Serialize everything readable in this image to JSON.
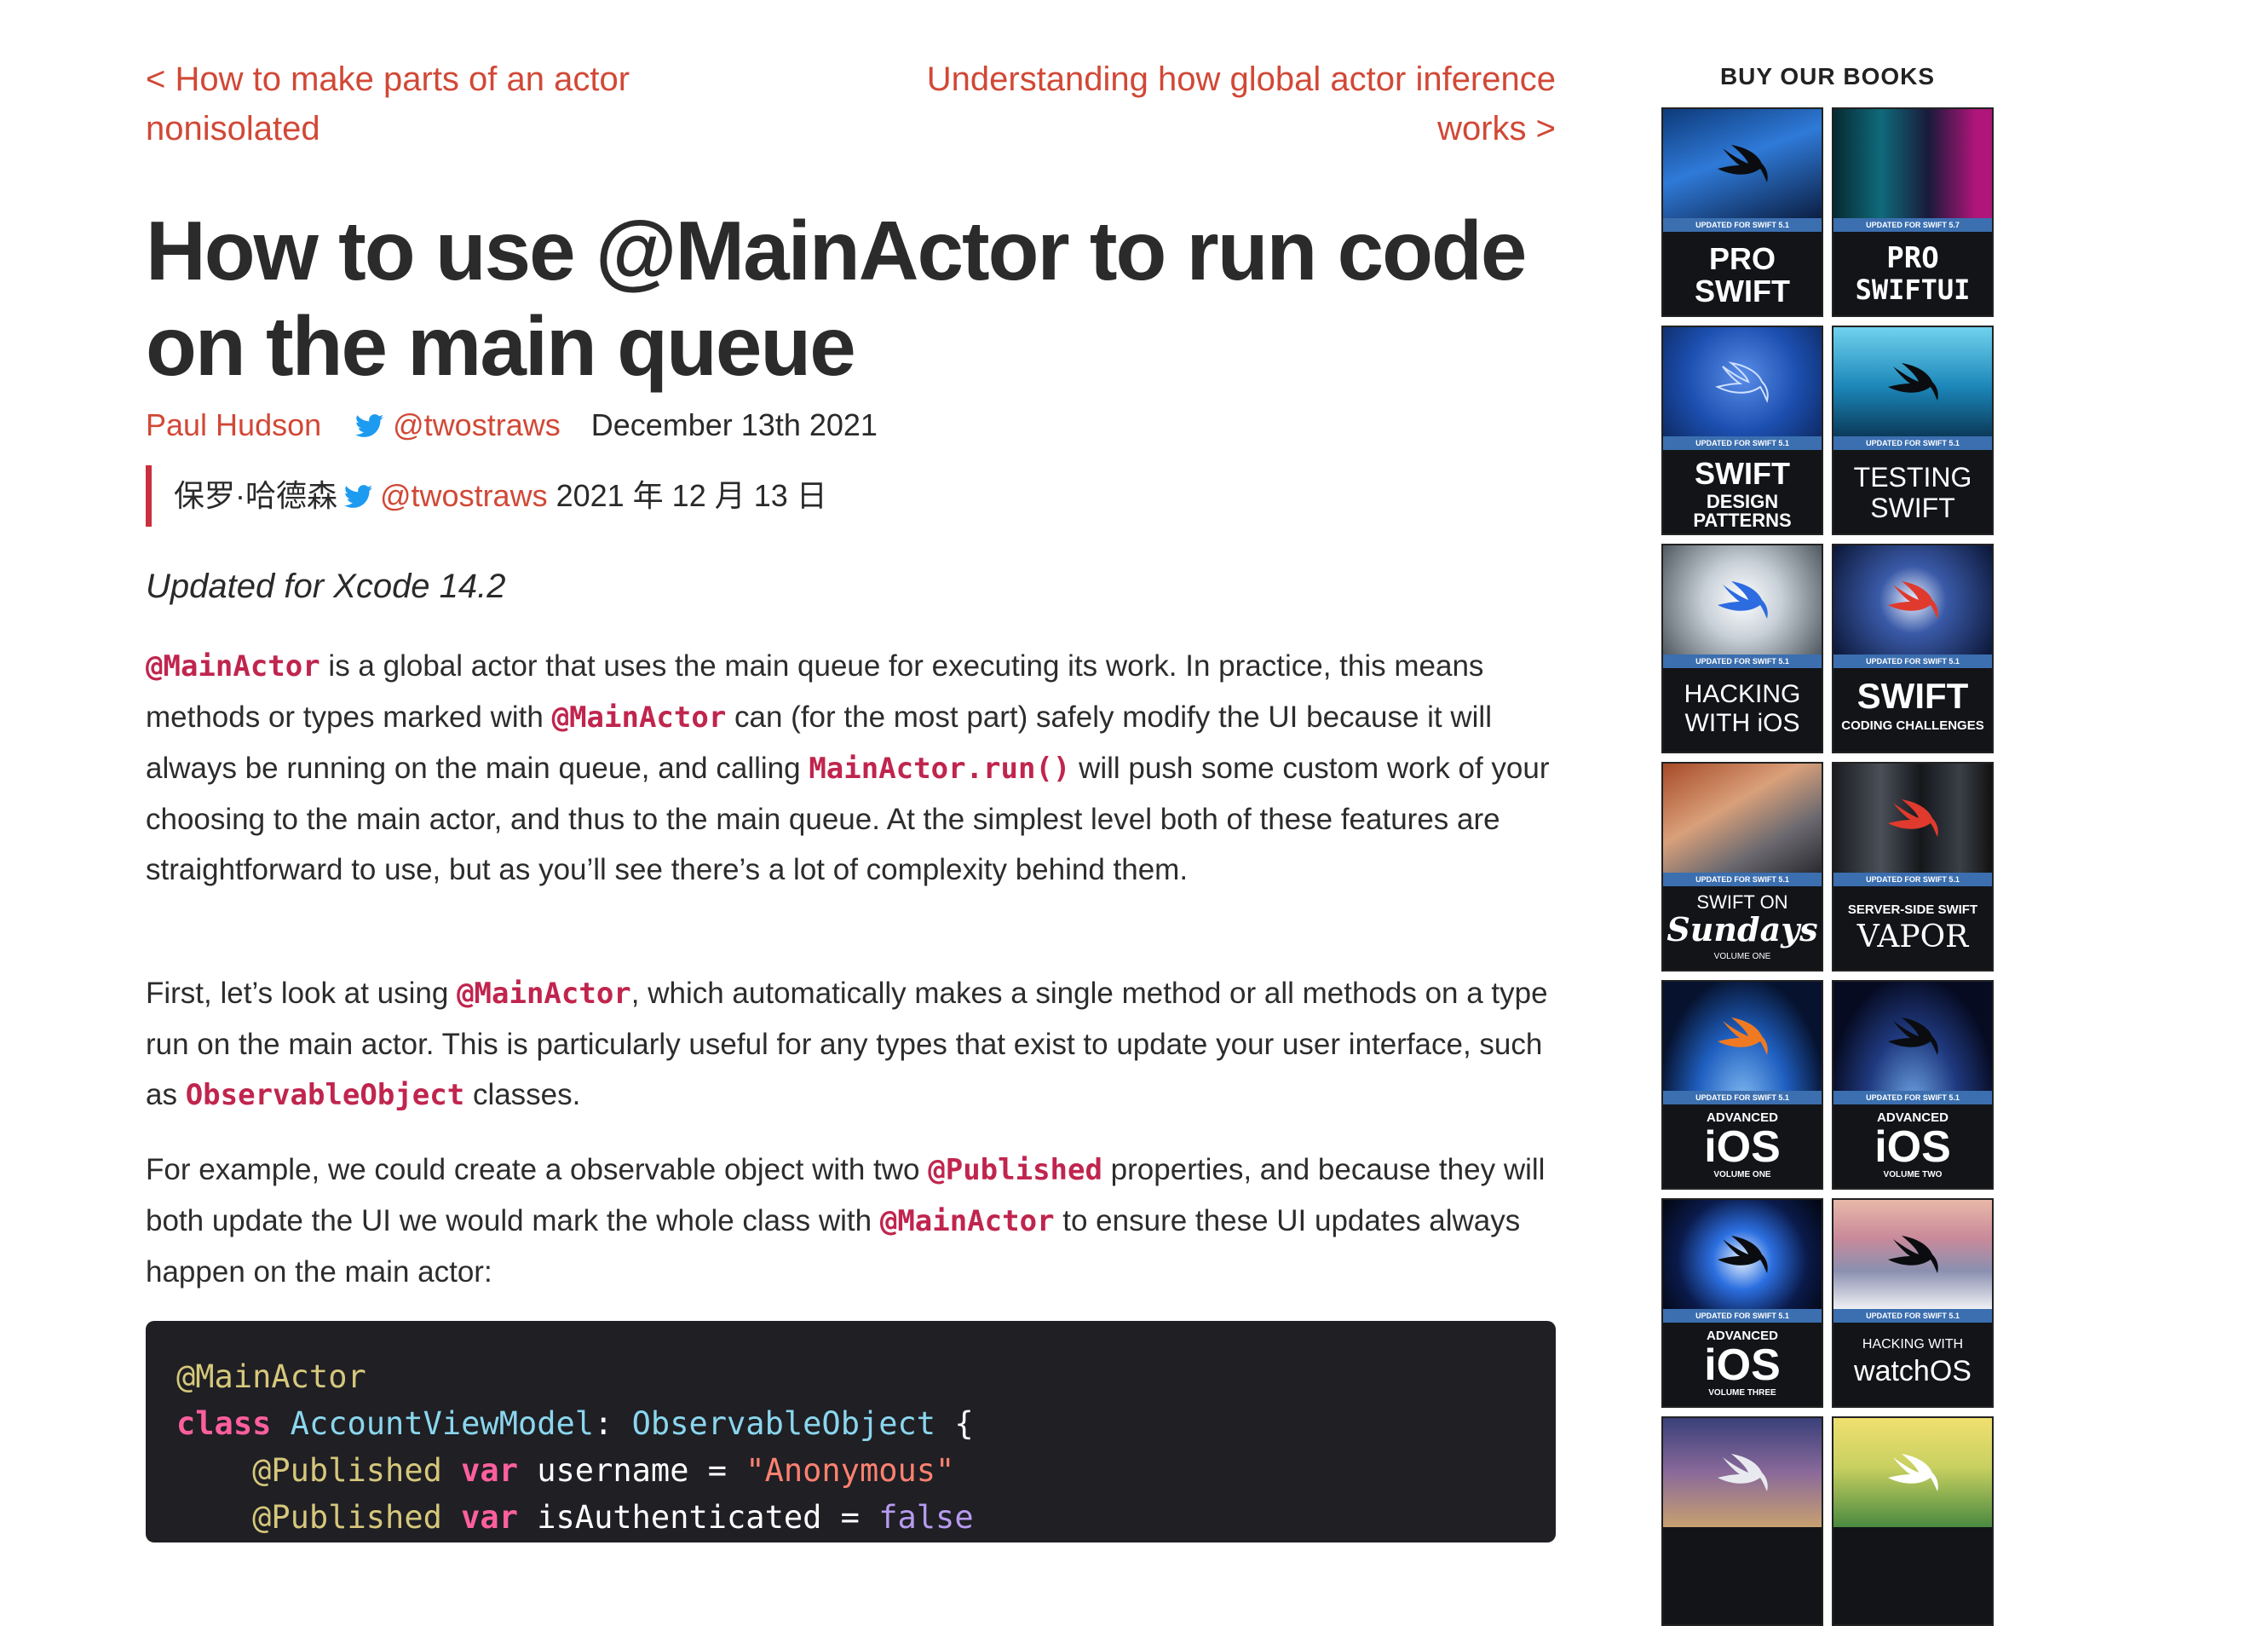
{
  "nav": {
    "prev": "< How to make parts of an actor nonisolated",
    "next": "Understanding how global actor inference works >"
  },
  "article": {
    "title": "How to use @MainActor to run code on the main queue",
    "author": "Paul Hudson",
    "twitter": "@twostraws",
    "date": "December 13th 2021",
    "translation": {
      "author": "保罗·哈德森",
      "twitter": "@twostraws",
      "date": "2021 年 12 月 13 日"
    },
    "updated": "Updated for Xcode 14.2",
    "p1": {
      "c1": "@MainActor",
      "t1": " is a global actor that uses the main queue for executing its work. In practice, this means methods or types marked with ",
      "c2": "@MainActor",
      "t2": " can (for the most part) safely modify the UI because it will always be running on the main queue, and calling ",
      "c3": "MainActor.run()",
      "t3": " will push some custom work of your choosing to the main actor, and thus to the main queue. At the simplest level both of these features are straightforward to use, but as you’ll see there’s a lot of complexity behind them."
    },
    "p2": {
      "t1": "First, let’s look at using ",
      "c1": "@MainActor",
      "t2": ", which automatically makes a single method or all methods on a type run on the main actor. This is particularly useful for any types that exist to update your user interface, such as ",
      "c2": "ObservableObject",
      "t3": " classes."
    },
    "p3": {
      "t1": "For example, we could create a observable object with two ",
      "c1": "@Published",
      "t2": " properties, and because they will both update the UI we would mark the whole class with ",
      "c2": "@MainActor",
      "t3": " to ensure these UI updates always happen on the main actor:"
    },
    "code": {
      "l1": "@MainActor",
      "l2_kw": "class",
      "l2_type": "AccountViewModel",
      "l2_colon": ": ",
      "l2_proto": "ObservableObject",
      "l2_brace": " {",
      "l3_attr": "@Published",
      "l3_kw": "var",
      "l3_name": " username = ",
      "l3_str": "\"Anonymous\"",
      "l4_attr": "@Published",
      "l4_kw": "var",
      "l4_name": " isAuthenticated = ",
      "l4_bool": "false"
    }
  },
  "sidebar": {
    "title": "BUY OUR BOOKS",
    "books": [
      {
        "band": "UPDATED FOR SWIFT 5.1",
        "line1": "PRO",
        "line2": "SWIFT"
      },
      {
        "band": "UPDATED FOR SWIFT 5.7",
        "line1": "PRO",
        "line2": "SWIFTUI"
      },
      {
        "band": "UPDATED FOR SWIFT 5.1",
        "line1": "SWIFT",
        "line2": "DESIGN PATTERNS"
      },
      {
        "band": "UPDATED FOR SWIFT 5.1",
        "line1": "TESTING",
        "line2": "SWIFT"
      },
      {
        "band": "UPDATED FOR SWIFT 5.1",
        "line1": "HACKING",
        "line2": "WITH iOS"
      },
      {
        "band": "UPDATED FOR SWIFT 5.1",
        "line1": "SWIFT",
        "line2": "CODING CHALLENGES"
      },
      {
        "band": "UPDATED FOR SWIFT 5.1",
        "line1": "SWIFT ON",
        "line2": "Sundays",
        "line3": "VOLUME ONE"
      },
      {
        "band": "UPDATED FOR SWIFT 5.1",
        "line1": "SERVER-SIDE SWIFT",
        "line2": "VAPOR"
      },
      {
        "band": "UPDATED FOR SWIFT 5.1",
        "line1": "ADVANCED",
        "line2": "iOS",
        "line3": "VOLUME ONE"
      },
      {
        "band": "UPDATED FOR SWIFT 5.1",
        "line1": "ADVANCED",
        "line2": "iOS",
        "line3": "VOLUME TWO"
      },
      {
        "band": "UPDATED FOR SWIFT 5.1",
        "line1": "ADVANCED",
        "line2": "iOS",
        "line3": "VOLUME THREE"
      },
      {
        "band": "UPDATED FOR SWIFT 5.1",
        "line1": "HACKING WITH",
        "line2": "watchOS"
      }
    ]
  },
  "colors": {
    "link": "#d14836",
    "inline_code": "#c0254e",
    "quote_bar": "#c9303f",
    "code_bg": "#1f1f24",
    "twitter_blue": "#1d9bf0"
  }
}
